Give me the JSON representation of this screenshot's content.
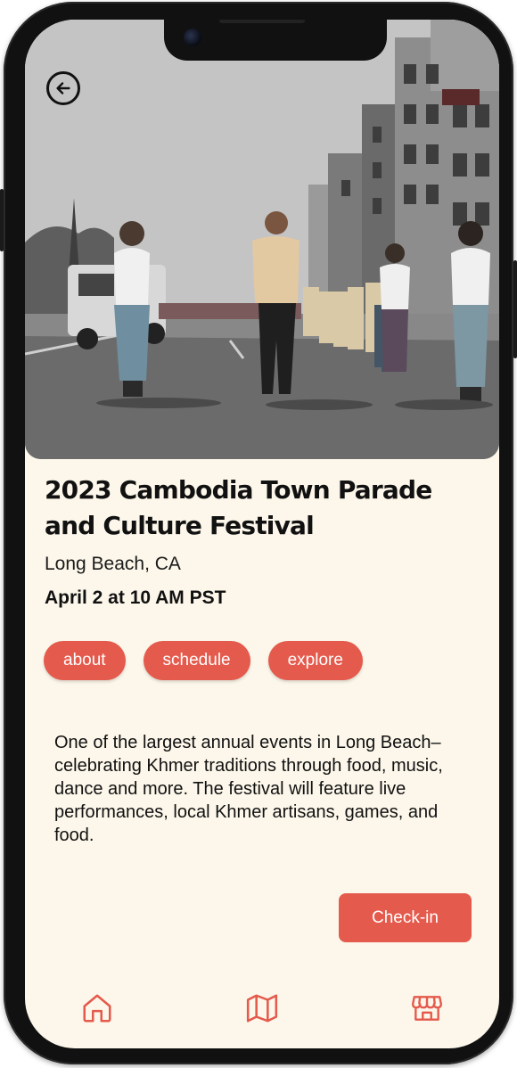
{
  "event": {
    "title": "2023 Cambodia Town Parade and Culture Festival",
    "location": "Long Beach, CA",
    "datetime": "April 2 at 10 AM PST",
    "description": "One of the largest annual events in Long Beach–celebrating Khmer traditions through food, music, dance and more. The festival will feature live performances, local Khmer artisans, games, and food."
  },
  "tabs": [
    {
      "label": "about"
    },
    {
      "label": "schedule"
    },
    {
      "label": "explore"
    }
  ],
  "actions": {
    "checkin_label": "Check-in"
  },
  "icons": {
    "back": "arrow-left-circle-icon",
    "nav": [
      "home-icon",
      "map-icon",
      "store-icon"
    ]
  },
  "colors": {
    "accent": "#e45a4c",
    "background": "#fcf7ea",
    "text": "#111111"
  }
}
